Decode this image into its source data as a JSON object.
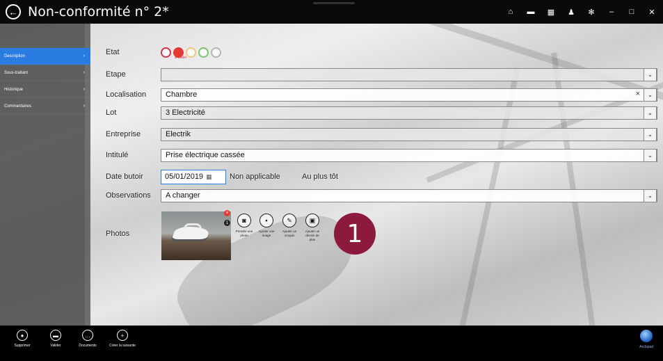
{
  "window": {
    "title": "Non-conformité n° 2*",
    "icons": [
      "home-icon",
      "folder-icon",
      "calendar-icon",
      "user-icon",
      "settings-icon",
      "minimize-icon",
      "maximize-icon",
      "close-icon"
    ]
  },
  "sidebar": {
    "items": [
      {
        "label": "Description",
        "active": true
      },
      {
        "label": "Sous-traitant",
        "active": false
      },
      {
        "label": "Historique",
        "active": false
      },
      {
        "label": "Commentaires",
        "active": false
      }
    ]
  },
  "form": {
    "etat": {
      "label": "Etat",
      "selected_caption": "À traiter",
      "colors": [
        "#d93050",
        "#e53935",
        "#f3c77a",
        "#7cc36a",
        "#b5b5b5"
      ]
    },
    "etape": {
      "label": "Etape",
      "value": ""
    },
    "localisation": {
      "label": "Localisation",
      "value": "Chambre"
    },
    "lot": {
      "label": "Lot",
      "value": "3 Electricité"
    },
    "entreprise": {
      "label": "Entreprise",
      "value": "Electrik"
    },
    "intitule": {
      "label": "Intitulé",
      "value": "Prise électrique cassée"
    },
    "date_butoir": {
      "label": "Date butoir",
      "value": "05/01/2019",
      "option_na": "Non applicable",
      "option_asap": "Au plus tôt"
    },
    "observations": {
      "label": "Observations",
      "value": "A changer"
    },
    "photos": {
      "label": "Photos",
      "count": "1",
      "actions": [
        {
          "icon": "camera-icon",
          "caption": "Prendre une photo"
        },
        {
          "icon": "image-icon",
          "caption": "Ajouter une image"
        },
        {
          "icon": "pencil-icon",
          "caption": "Ajouter un croquis"
        },
        {
          "icon": "plan-icon",
          "caption": "Ajouter un dessin de plan"
        }
      ]
    }
  },
  "callout": {
    "number": "1",
    "color": "#8b1a3d"
  },
  "bottombar": {
    "items": [
      {
        "label": "Supprimer",
        "icon": "delete-icon"
      },
      {
        "label": "Valider",
        "icon": "save-icon"
      },
      {
        "label": "Documents",
        "icon": "document-icon"
      },
      {
        "label": "Créer la suivante",
        "icon": "add-icon"
      }
    ],
    "brand": "Archipad"
  },
  "accent": "#2b7ce0"
}
